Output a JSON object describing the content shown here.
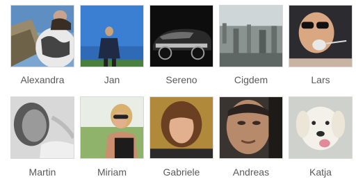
{
  "friends": [
    {
      "name": "Alexandra",
      "photo": "photo-alexandra"
    },
    {
      "name": "Jan",
      "photo": "photo-jan"
    },
    {
      "name": "Sereno",
      "photo": "photo-sereno-car"
    },
    {
      "name": "Cigdem",
      "photo": "photo-cigdem-city"
    },
    {
      "name": "Lars",
      "photo": "photo-lars"
    },
    {
      "name": "Martin",
      "photo": "photo-martin"
    },
    {
      "name": "Miriam",
      "photo": "photo-miriam"
    },
    {
      "name": "Gabriele",
      "photo": "photo-gabriele"
    },
    {
      "name": "Andreas",
      "photo": "photo-andreas"
    },
    {
      "name": "Katja",
      "photo": "photo-katja-dog"
    }
  ]
}
